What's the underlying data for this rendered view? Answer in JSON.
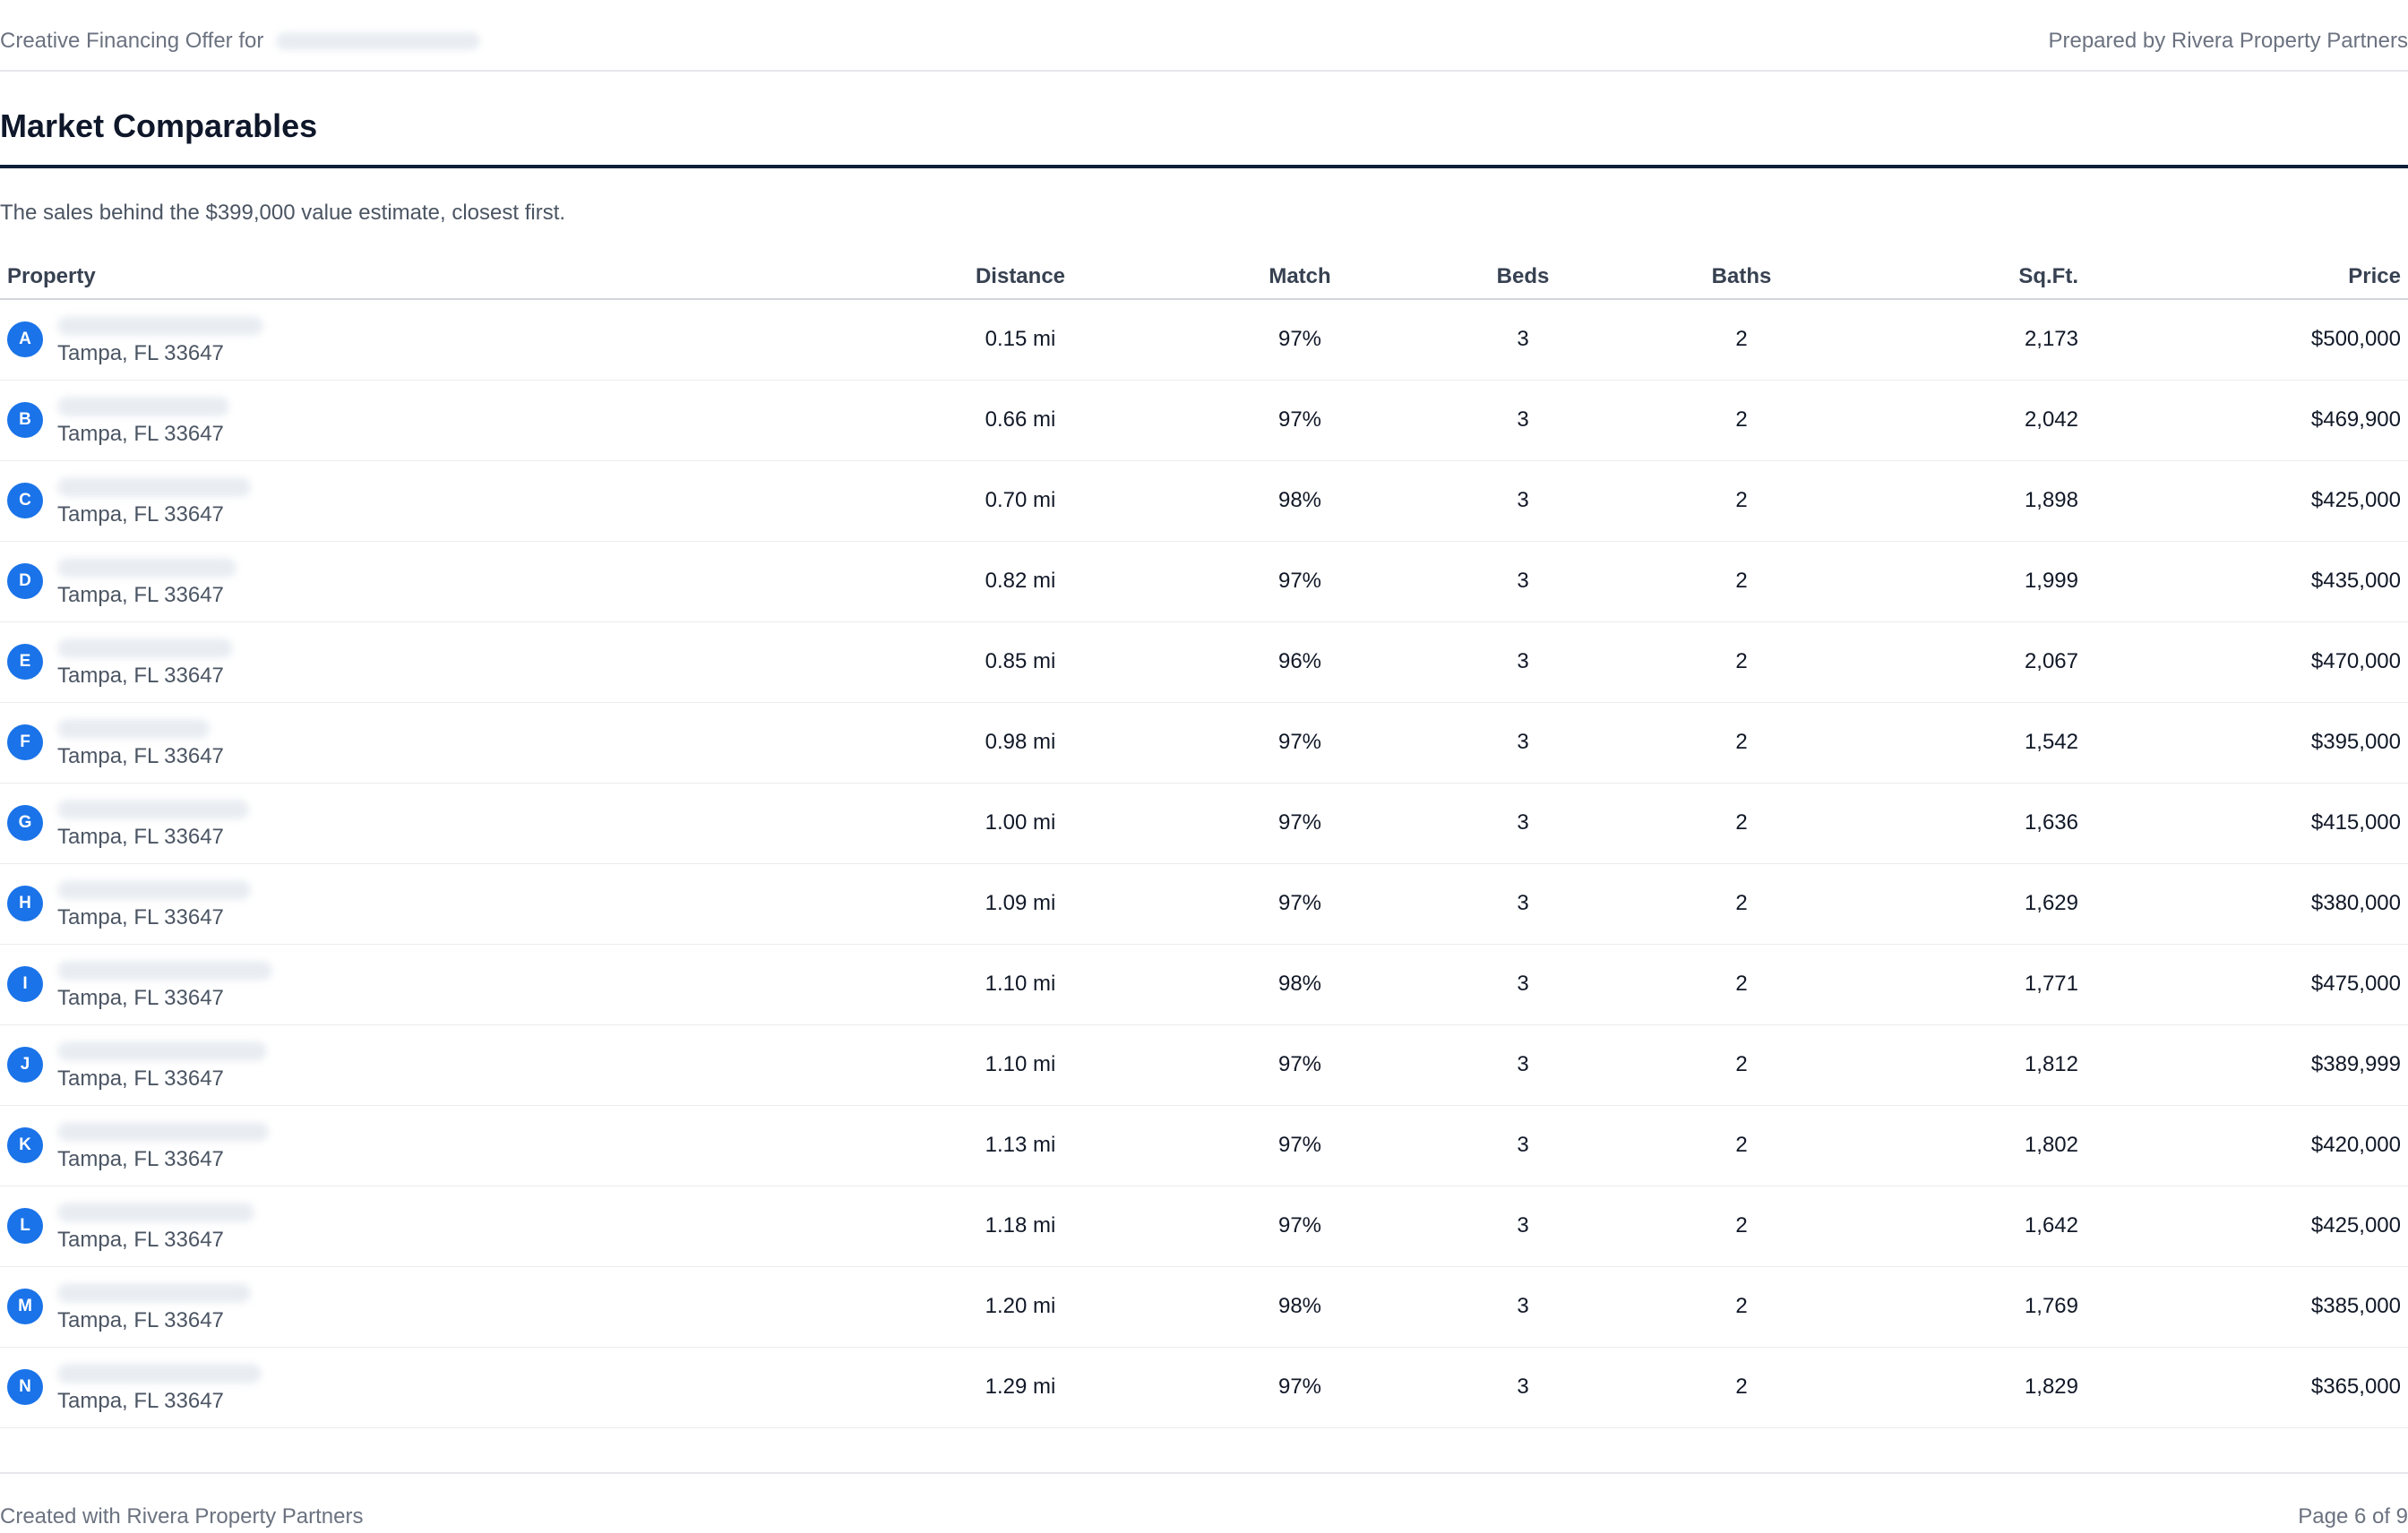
{
  "header": {
    "offer_title": "Creative Financing Offer for",
    "prepared_by": "Prepared by Rivera Property Partners"
  },
  "section": {
    "title": "Market Comparables",
    "subtitle": "The sales behind the $399,000 value estimate, closest first."
  },
  "table": {
    "columns": [
      "Property",
      "Distance",
      "Match",
      "Beds",
      "Baths",
      "Sq.Ft.",
      "Price"
    ],
    "rows": [
      {
        "marker": "A",
        "city": "Tampa, FL 33647",
        "distance": "0.15 mi",
        "match": "97%",
        "beds": "3",
        "baths": "2",
        "sqft": "2,173",
        "price": "$500,000"
      },
      {
        "marker": "B",
        "city": "Tampa, FL 33647",
        "distance": "0.66 mi",
        "match": "97%",
        "beds": "3",
        "baths": "2",
        "sqft": "2,042",
        "price": "$469,900"
      },
      {
        "marker": "C",
        "city": "Tampa, FL 33647",
        "distance": "0.70 mi",
        "match": "98%",
        "beds": "3",
        "baths": "2",
        "sqft": "1,898",
        "price": "$425,000"
      },
      {
        "marker": "D",
        "city": "Tampa, FL 33647",
        "distance": "0.82 mi",
        "match": "97%",
        "beds": "3",
        "baths": "2",
        "sqft": "1,999",
        "price": "$435,000"
      },
      {
        "marker": "E",
        "city": "Tampa, FL 33647",
        "distance": "0.85 mi",
        "match": "96%",
        "beds": "3",
        "baths": "2",
        "sqft": "2,067",
        "price": "$470,000"
      },
      {
        "marker": "F",
        "city": "Tampa, FL 33647",
        "distance": "0.98 mi",
        "match": "97%",
        "beds": "3",
        "baths": "2",
        "sqft": "1,542",
        "price": "$395,000"
      },
      {
        "marker": "G",
        "city": "Tampa, FL 33647",
        "distance": "1.00 mi",
        "match": "97%",
        "beds": "3",
        "baths": "2",
        "sqft": "1,636",
        "price": "$415,000"
      },
      {
        "marker": "H",
        "city": "Tampa, FL 33647",
        "distance": "1.09 mi",
        "match": "97%",
        "beds": "3",
        "baths": "2",
        "sqft": "1,629",
        "price": "$380,000"
      },
      {
        "marker": "I",
        "city": "Tampa, FL 33647",
        "distance": "1.10 mi",
        "match": "98%",
        "beds": "3",
        "baths": "2",
        "sqft": "1,771",
        "price": "$475,000"
      },
      {
        "marker": "J",
        "city": "Tampa, FL 33647",
        "distance": "1.10 mi",
        "match": "97%",
        "beds": "3",
        "baths": "2",
        "sqft": "1,812",
        "price": "$389,999"
      },
      {
        "marker": "K",
        "city": "Tampa, FL 33647",
        "distance": "1.13 mi",
        "match": "97%",
        "beds": "3",
        "baths": "2",
        "sqft": "1,802",
        "price": "$420,000"
      },
      {
        "marker": "L",
        "city": "Tampa, FL 33647",
        "distance": "1.18 mi",
        "match": "97%",
        "beds": "3",
        "baths": "2",
        "sqft": "1,642",
        "price": "$425,000"
      },
      {
        "marker": "M",
        "city": "Tampa, FL 33647",
        "distance": "1.20 mi",
        "match": "98%",
        "beds": "3",
        "baths": "2",
        "sqft": "1,769",
        "price": "$385,000"
      },
      {
        "marker": "N",
        "city": "Tampa, FL 33647",
        "distance": "1.29 mi",
        "match": "97%",
        "beds": "3",
        "baths": "2",
        "sqft": "1,829",
        "price": "$365,000"
      }
    ]
  },
  "footer": {
    "created_with": "Created with Rivera Property Partners",
    "page_number": "Page 6 of 9"
  },
  "colors": {
    "marker": "#1a73e8",
    "title_rule": "#0f1f3a"
  }
}
